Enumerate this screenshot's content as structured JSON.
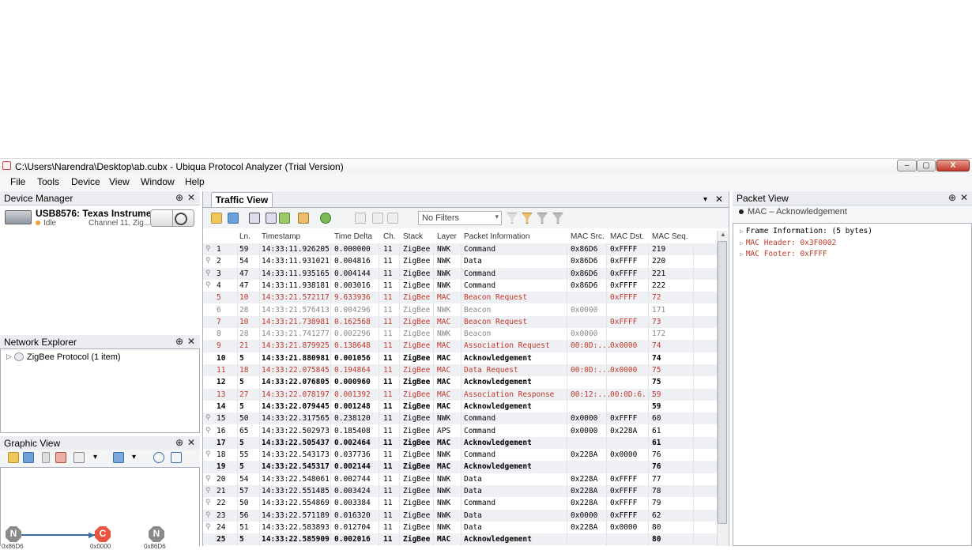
{
  "window": {
    "title": "C:\\Users\\Narendra\\Desktop\\ab.cubx - Ubiqua Protocol Analyzer (Trial Version)",
    "min_glyph": "‒",
    "max_glyph": "▢",
    "close_glyph": "X"
  },
  "menu": [
    "File",
    "Tools",
    "Device",
    "View",
    "Window",
    "Help"
  ],
  "panel_controls": {
    "pin": "⊕",
    "close": "✕",
    "dropdown": "▾"
  },
  "device_manager": {
    "title": "Device Manager",
    "device_name": "USB8576: Texas Instrume...",
    "status": "Idle",
    "channel": "Channel 11, Zig..."
  },
  "network_explorer": {
    "title": "Network Explorer",
    "tree_item": "ZigBee Protocol (1 item)"
  },
  "graphic_view": {
    "title": "Graphic View",
    "nodes": [
      {
        "letter": "N",
        "label": "0x86D6",
        "color": "#8a8a8a"
      },
      {
        "letter": "C",
        "label": "0x0000",
        "color": "#e8553e"
      },
      {
        "letter": "N",
        "label": "0x86D6",
        "color": "#8a8a8a"
      }
    ]
  },
  "traffic_view": {
    "tab": "Traffic View",
    "filter": "No Filters",
    "columns": [
      "Ln.",
      "Timestamp",
      "Time Delta",
      "Ch.",
      "Stack",
      "Layer",
      "Packet Information",
      "MAC Src.",
      "MAC Dst.",
      "MAC Seq."
    ],
    "rows": [
      {
        "n": "1",
        "ln": "59",
        "ts": "14:33:11.926205",
        "td": "0.000000",
        "ch": "11",
        "stack": "ZigBee",
        "layer": "NWK",
        "info": "Command",
        "src": "0x86D6",
        "dst": "0xFFFF",
        "seq": "219",
        "style": "",
        "icon": true
      },
      {
        "n": "2",
        "ln": "54",
        "ts": "14:33:11.931021",
        "td": "0.004816",
        "ch": "11",
        "stack": "ZigBee",
        "layer": "NWK",
        "info": "Data",
        "src": "0x86D6",
        "dst": "0xFFFF",
        "seq": "220",
        "style": "",
        "icon": true
      },
      {
        "n": "3",
        "ln": "47",
        "ts": "14:33:11.935165",
        "td": "0.004144",
        "ch": "11",
        "stack": "ZigBee",
        "layer": "NWK",
        "info": "Command",
        "src": "0x86D6",
        "dst": "0xFFFF",
        "seq": "221",
        "style": "",
        "icon": true
      },
      {
        "n": "4",
        "ln": "47",
        "ts": "14:33:11.938181",
        "td": "0.003016",
        "ch": "11",
        "stack": "ZigBee",
        "layer": "NWK",
        "info": "Command",
        "src": "0x86D6",
        "dst": "0xFFFF",
        "seq": "222",
        "style": "",
        "icon": true
      },
      {
        "n": "5",
        "ln": "10",
        "ts": "14:33:21.572117",
        "td": "9.633936",
        "ch": "11",
        "stack": "ZigBee",
        "layer": "MAC",
        "info": "Beacon Request",
        "src": "",
        "dst": "0xFFFF",
        "seq": "72",
        "style": "red",
        "icon": false
      },
      {
        "n": "6",
        "ln": "28",
        "ts": "14:33:21.576413",
        "td": "0.004296",
        "ch": "11",
        "stack": "ZigBee",
        "layer": "NWK",
        "info": "Beacon",
        "src": "0x0000",
        "dst": "",
        "seq": "171",
        "style": "gray",
        "icon": false
      },
      {
        "n": "7",
        "ln": "10",
        "ts": "14:33:21.738981",
        "td": "0.162568",
        "ch": "11",
        "stack": "ZigBee",
        "layer": "MAC",
        "info": "Beacon Request",
        "src": "",
        "dst": "0xFFFF",
        "seq": "73",
        "style": "red",
        "icon": false
      },
      {
        "n": "8",
        "ln": "28",
        "ts": "14:33:21.741277",
        "td": "0.002296",
        "ch": "11",
        "stack": "ZigBee",
        "layer": "NWK",
        "info": "Beacon",
        "src": "0x0000",
        "dst": "",
        "seq": "172",
        "style": "gray",
        "icon": false
      },
      {
        "n": "9",
        "ln": "21",
        "ts": "14:33:21.879925",
        "td": "0.138648",
        "ch": "11",
        "stack": "ZigBee",
        "layer": "MAC",
        "info": "Association Request",
        "src": "00:0D:...",
        "dst": "0x0000",
        "seq": "74",
        "style": "red",
        "icon": false
      },
      {
        "n": "10",
        "ln": "5",
        "ts": "14:33:21.880981",
        "td": "0.001056",
        "ch": "11",
        "stack": "ZigBee",
        "layer": "MAC",
        "info": "Acknowledgement",
        "src": "",
        "dst": "",
        "seq": "74",
        "style": "bold",
        "icon": false
      },
      {
        "n": "11",
        "ln": "18",
        "ts": "14:33:22.075845",
        "td": "0.194864",
        "ch": "11",
        "stack": "ZigBee",
        "layer": "MAC",
        "info": "Data Request",
        "src": "00:0D:...",
        "dst": "0x0000",
        "seq": "75",
        "style": "red",
        "icon": false
      },
      {
        "n": "12",
        "ln": "5",
        "ts": "14:33:22.076805",
        "td": "0.000960",
        "ch": "11",
        "stack": "ZigBee",
        "layer": "MAC",
        "info": "Acknowledgement",
        "src": "",
        "dst": "",
        "seq": "75",
        "style": "bold",
        "icon": false
      },
      {
        "n": "13",
        "ln": "27",
        "ts": "14:33:22.078197",
        "td": "0.001392",
        "ch": "11",
        "stack": "ZigBee",
        "layer": "MAC",
        "info": "Association Response",
        "src": "00:12:...",
        "dst": "00:0D:6...",
        "seq": "59",
        "style": "red",
        "icon": false
      },
      {
        "n": "14",
        "ln": "5",
        "ts": "14:33:22.079445",
        "td": "0.001248",
        "ch": "11",
        "stack": "ZigBee",
        "layer": "MAC",
        "info": "Acknowledgement",
        "src": "",
        "dst": "",
        "seq": "59",
        "style": "bold",
        "icon": false
      },
      {
        "n": "15",
        "ln": "50",
        "ts": "14:33:22.317565",
        "td": "0.238120",
        "ch": "11",
        "stack": "ZigBee",
        "layer": "NWK",
        "info": "Command",
        "src": "0x0000",
        "dst": "0xFFFF",
        "seq": "60",
        "style": "",
        "icon": true
      },
      {
        "n": "16",
        "ln": "65",
        "ts": "14:33:22.502973",
        "td": "0.185408",
        "ch": "11",
        "stack": "ZigBee",
        "layer": "APS",
        "info": "Command",
        "src": "0x0000",
        "dst": "0x228A",
        "seq": "61",
        "style": "",
        "icon": true
      },
      {
        "n": "17",
        "ln": "5",
        "ts": "14:33:22.505437",
        "td": "0.002464",
        "ch": "11",
        "stack": "ZigBee",
        "layer": "MAC",
        "info": "Acknowledgement",
        "src": "",
        "dst": "",
        "seq": "61",
        "style": "bold",
        "icon": false
      },
      {
        "n": "18",
        "ln": "55",
        "ts": "14:33:22.543173",
        "td": "0.037736",
        "ch": "11",
        "stack": "ZigBee",
        "layer": "NWK",
        "info": "Command",
        "src": "0x228A",
        "dst": "0x0000",
        "seq": "76",
        "style": "",
        "icon": true
      },
      {
        "n": "19",
        "ln": "5",
        "ts": "14:33:22.545317",
        "td": "0.002144",
        "ch": "11",
        "stack": "ZigBee",
        "layer": "MAC",
        "info": "Acknowledgement",
        "src": "",
        "dst": "",
        "seq": "76",
        "style": "bold",
        "icon": false
      },
      {
        "n": "20",
        "ln": "54",
        "ts": "14:33:22.548061",
        "td": "0.002744",
        "ch": "11",
        "stack": "ZigBee",
        "layer": "NWK",
        "info": "Data",
        "src": "0x228A",
        "dst": "0xFFFF",
        "seq": "77",
        "style": "",
        "icon": true
      },
      {
        "n": "21",
        "ln": "57",
        "ts": "14:33:22.551485",
        "td": "0.003424",
        "ch": "11",
        "stack": "ZigBee",
        "layer": "NWK",
        "info": "Data",
        "src": "0x228A",
        "dst": "0xFFFF",
        "seq": "78",
        "style": "",
        "icon": true
      },
      {
        "n": "22",
        "ln": "50",
        "ts": "14:33:22.554869",
        "td": "0.003384",
        "ch": "11",
        "stack": "ZigBee",
        "layer": "NWK",
        "info": "Command",
        "src": "0x228A",
        "dst": "0xFFFF",
        "seq": "79",
        "style": "",
        "icon": true
      },
      {
        "n": "23",
        "ln": "56",
        "ts": "14:33:22.571189",
        "td": "0.016320",
        "ch": "11",
        "stack": "ZigBee",
        "layer": "NWK",
        "info": "Data",
        "src": "0x0000",
        "dst": "0xFFFF",
        "seq": "62",
        "style": "",
        "icon": true
      },
      {
        "n": "24",
        "ln": "51",
        "ts": "14:33:22.583893",
        "td": "0.012704",
        "ch": "11",
        "stack": "ZigBee",
        "layer": "NWK",
        "info": "Data",
        "src": "0x228A",
        "dst": "0x0000",
        "seq": "80",
        "style": "",
        "icon": true
      },
      {
        "n": "25",
        "ln": "5",
        "ts": "14:33:22.585909",
        "td": "0.002016",
        "ch": "11",
        "stack": "ZigBee",
        "layer": "MAC",
        "info": "Acknowledgement",
        "src": "",
        "dst": "",
        "seq": "80",
        "style": "bold",
        "icon": false
      }
    ]
  },
  "packet_view": {
    "title": "Packet View",
    "selected": "MAC – Acknowledgement",
    "lines": [
      {
        "text": "Frame Information: (5 bytes)",
        "color": "#000000"
      },
      {
        "text": "MAC Header: 0x3F0002",
        "color": "#c0392b"
      },
      {
        "text": "MAC Footer: 0xFFFF",
        "color": "#c0392b"
      }
    ]
  }
}
